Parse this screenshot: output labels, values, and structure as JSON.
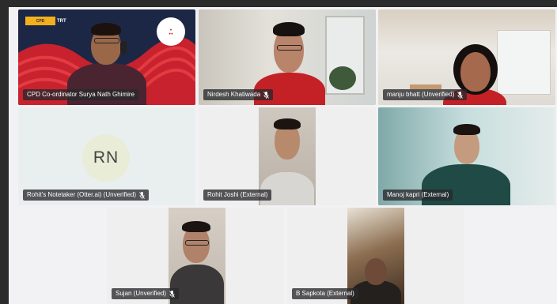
{
  "participants": [
    {
      "name": "CPD Co-ordinator Surya Nath Ghimire",
      "muted": false
    },
    {
      "name": "Nirdesh Khatiwada",
      "muted": true
    },
    {
      "name": "manju bhatt (Unverified)",
      "muted": true
    },
    {
      "name": "Rohit's Notetaker (Otter.ai) (Unverified)",
      "muted": true,
      "initials": "RN"
    },
    {
      "name": "Rohit Joshi (External)",
      "muted": false
    },
    {
      "name": "Manoj kapri (External)",
      "muted": false
    },
    {
      "name": "Sujan (Unverified)",
      "muted": true
    },
    {
      "name": "B Sapkota (External)",
      "muted": false
    }
  ],
  "colors": {
    "tile_bg": "#eeeeef",
    "name_pill": "#28282c",
    "avatar_bg": "#e9ecd7"
  },
  "icons": {
    "muted": "mic-off-icon"
  }
}
